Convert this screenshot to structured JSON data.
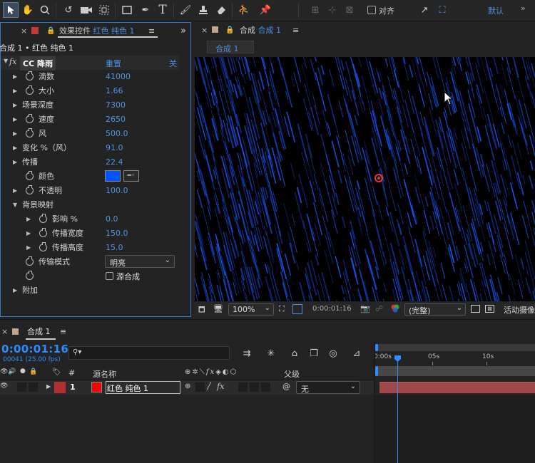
{
  "toolbar": {
    "snap_label": "对齐",
    "workspace_label": "默认"
  },
  "effects_panel": {
    "tab_title": "效果控件 红色 纯色 1",
    "tab_title_prefix": "效果控件 ",
    "tab_title_layer": "红色 纯色 1",
    "breadcrumb": "合成 1 • 红色 纯色 1",
    "effect_name": "CC 降雨",
    "reset_label": "重置",
    "about_label": "关",
    "props": [
      {
        "label": "滴数",
        "value": "41000"
      },
      {
        "label": "大小",
        "value": "1.66"
      },
      {
        "label": "场景深度",
        "value": "7300"
      },
      {
        "label": "速度",
        "value": "2650"
      },
      {
        "label": "风",
        "value": "500.0"
      },
      {
        "label": "变化 %（风）",
        "value": "91.0"
      },
      {
        "label": "传播",
        "value": "22.4"
      },
      {
        "label": "颜色",
        "value": ""
      },
      {
        "label": "不透明",
        "value": "100.0"
      },
      {
        "label": "背景映射",
        "value": ""
      },
      {
        "label": "影响 %",
        "value": "0.0"
      },
      {
        "label": "传播宽度",
        "value": "150.0"
      },
      {
        "label": "传播高度",
        "value": "15.0"
      },
      {
        "label": "传输模式",
        "value": "明亮"
      },
      {
        "label": "",
        "value": "源合成"
      },
      {
        "label": "附加",
        "value": ""
      }
    ],
    "color_swatch": "#0055ff"
  },
  "comp_panel": {
    "tab_prefix": "合成 ",
    "tab_name": "合成 1",
    "subtab": "合成 1",
    "zoom": "100%",
    "timecode": "0:00:01:16",
    "quality": "(完整)",
    "active_camera": "活动摄像"
  },
  "timeline": {
    "tab_name": "合成 1",
    "timecode": "0:00:01:16",
    "frame_info": "00041 (25.00 fps)",
    "col_num": "#",
    "col_source": "源名称",
    "col_parent": "父级",
    "ruler": [
      "0:00s",
      "05s",
      "10s"
    ],
    "layer": {
      "num": "1",
      "name": "红色 纯色 1",
      "parent": "无",
      "color": "#ff0000",
      "label_color": "#b03030"
    }
  },
  "colors": {
    "accent": "#2d8cff",
    "rain": "#1a55e0",
    "bar": "#a04848"
  }
}
